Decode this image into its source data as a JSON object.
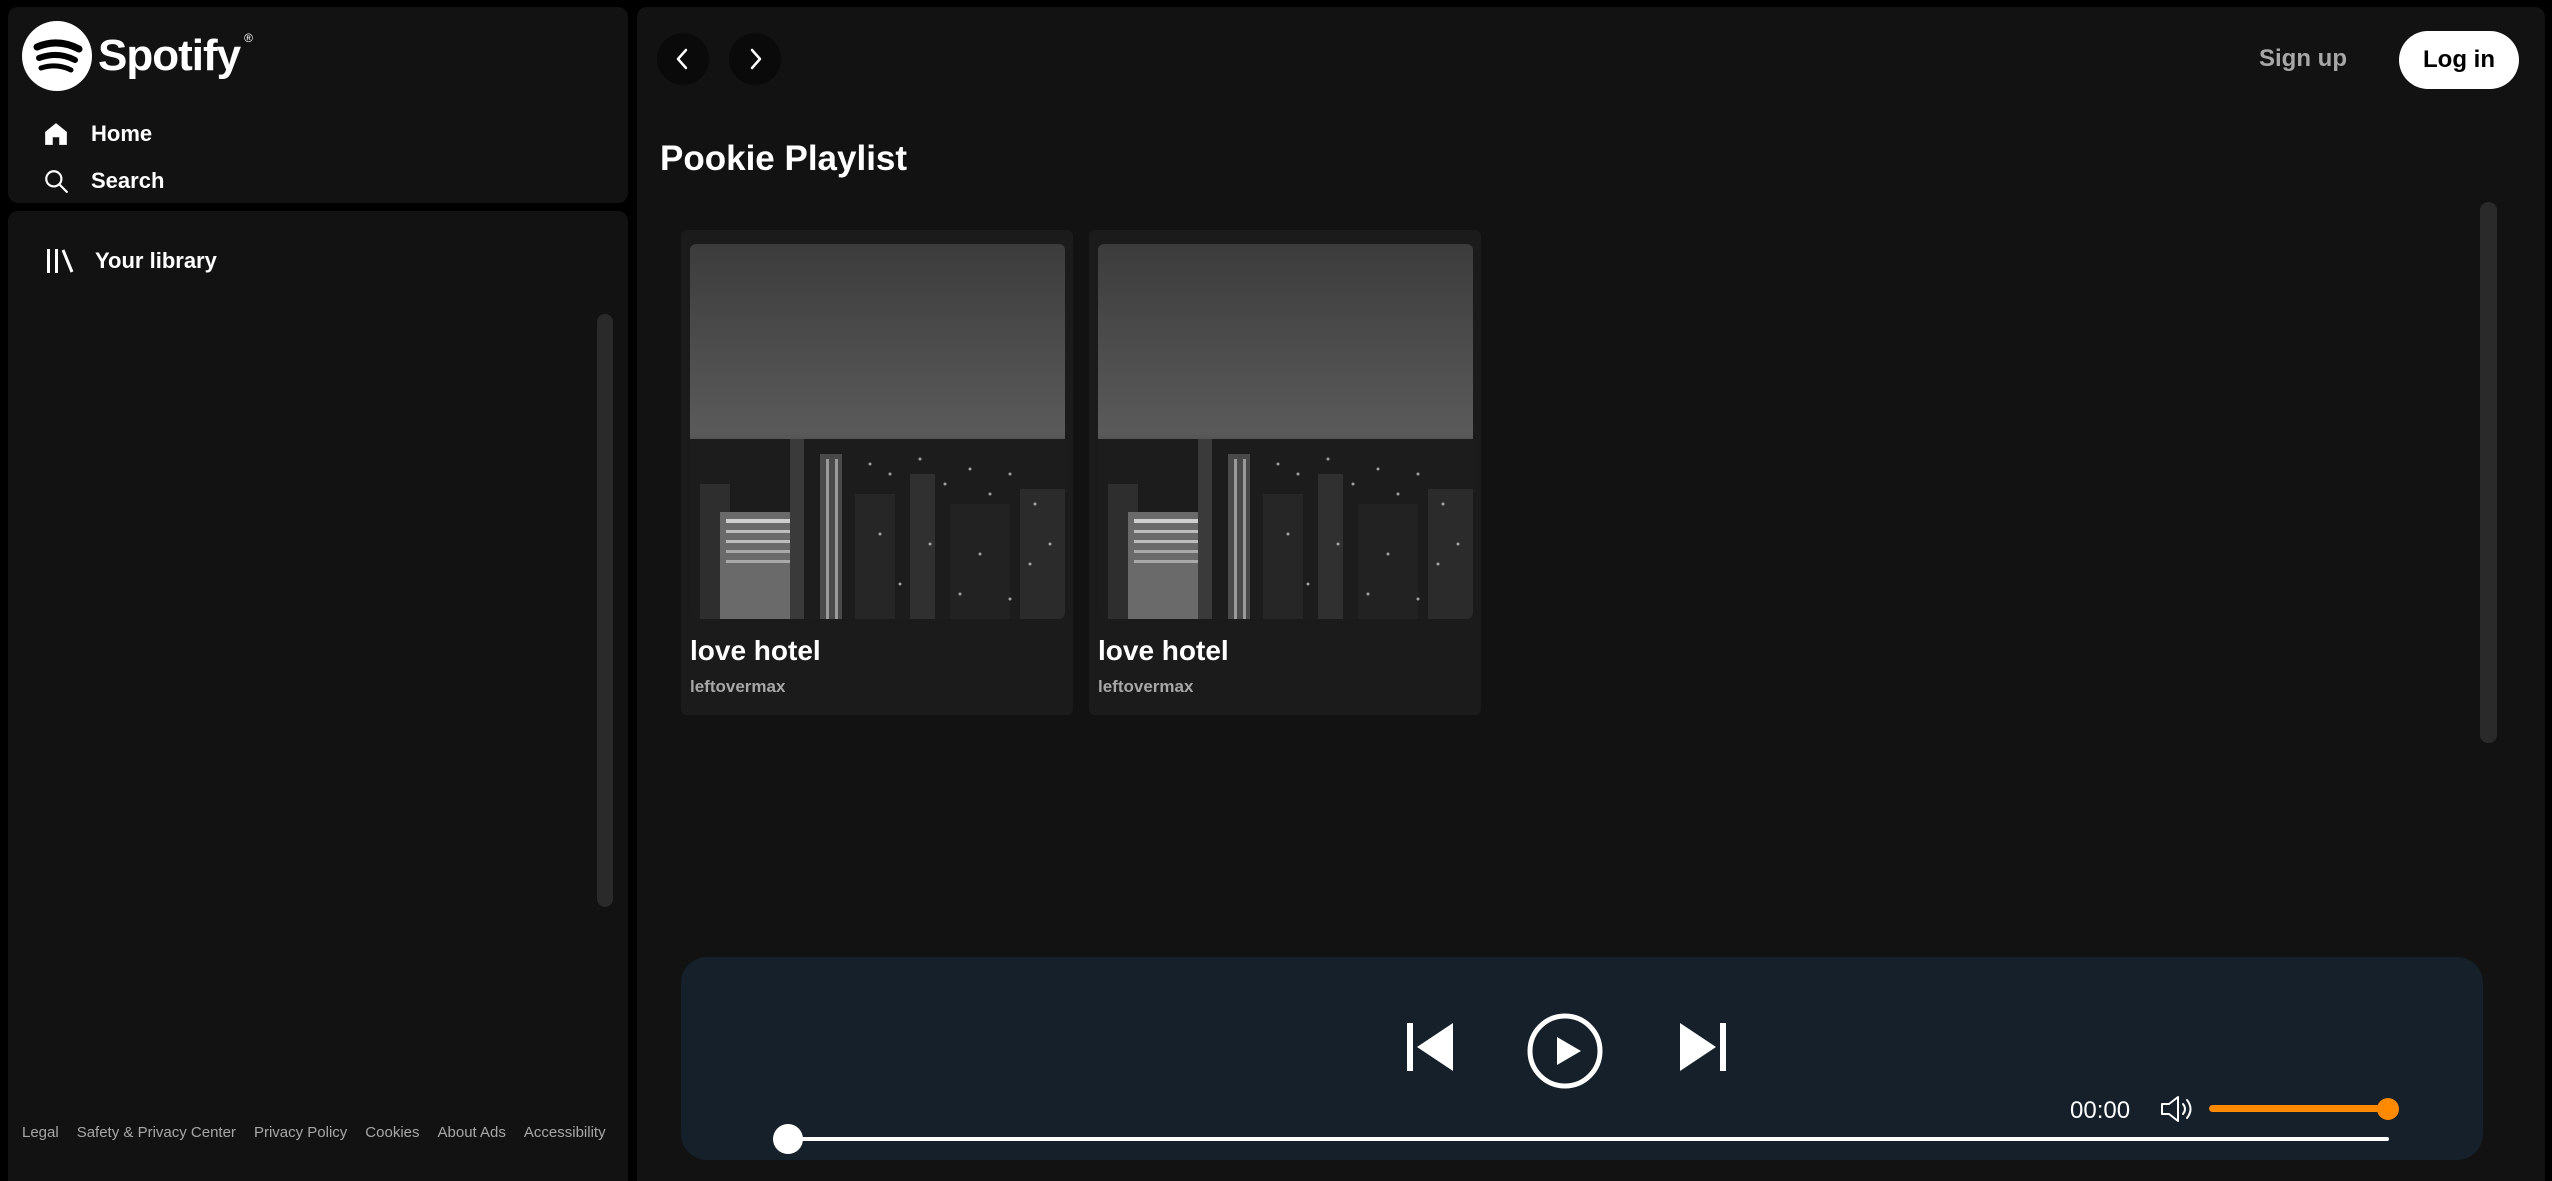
{
  "brand": {
    "name": "Spotify",
    "reg": "®"
  },
  "nav": {
    "home": "Home",
    "search": "Search"
  },
  "library": {
    "title": "Your library"
  },
  "footer": [
    "Legal",
    "Safety & Privacy Center",
    "Privacy Policy",
    "Cookies",
    "About Ads",
    "Accessibility"
  ],
  "header": {
    "signup": "Sign up",
    "login": "Log in"
  },
  "page": {
    "title": "Pookie Playlist"
  },
  "cards": [
    {
      "title": "love hotel",
      "artist": "leftovermax",
      "cover": "city-night-cover"
    },
    {
      "title": "love hotel",
      "artist": "leftovermax",
      "cover": "city-night-cover"
    }
  ],
  "player": {
    "time": "00:00",
    "progress": 0,
    "volume": 1.0,
    "accent": "#ff8a00",
    "background": "#15202a"
  }
}
